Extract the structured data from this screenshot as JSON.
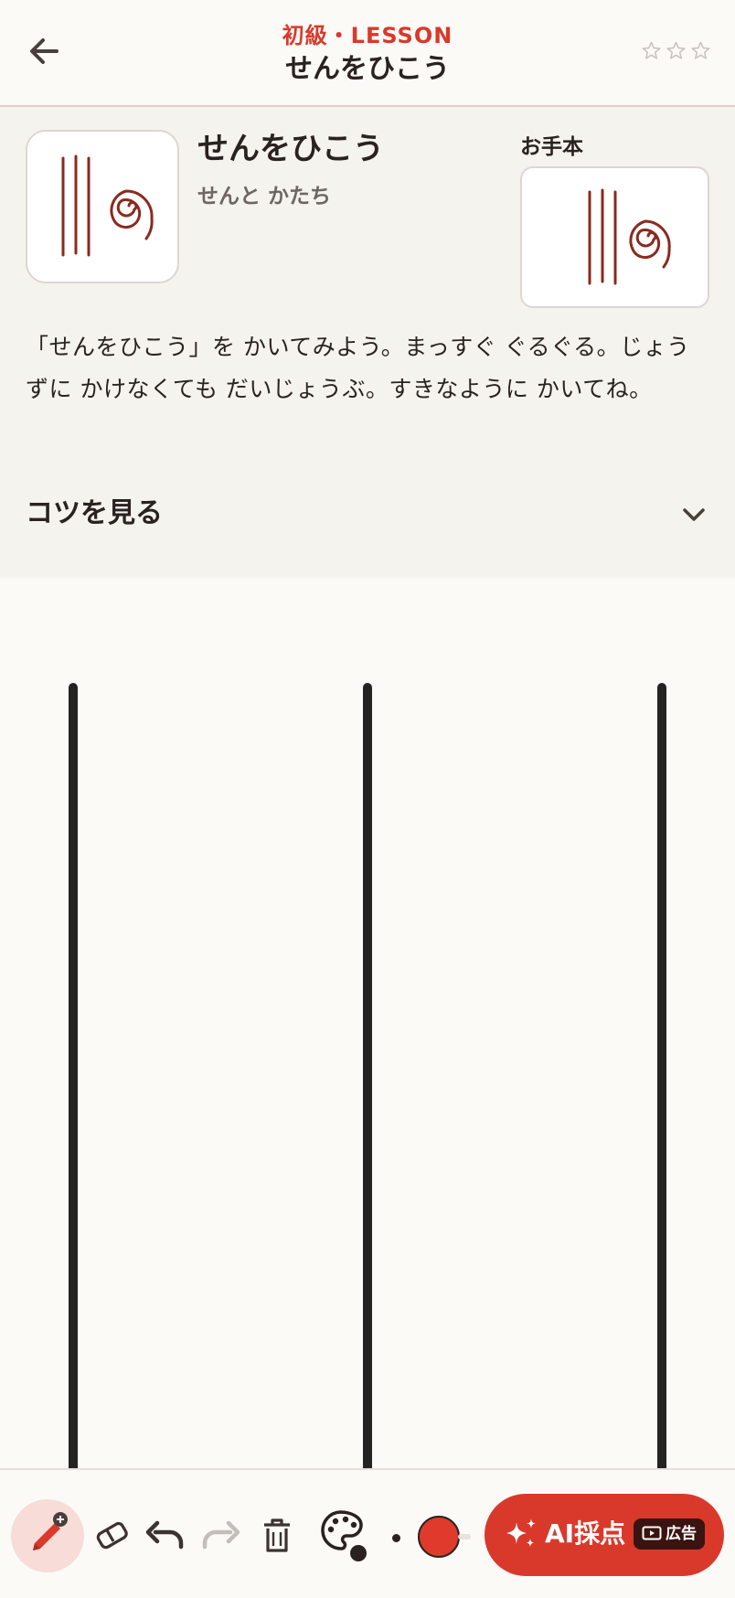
{
  "header": {
    "back_icon": "arrow-left-icon",
    "level_lesson": "初級・LESSON",
    "title": "せんをひこう",
    "stars": {
      "earned": 0,
      "total": 3
    }
  },
  "lesson": {
    "title": "せんをひこう",
    "category": "せんと かたち",
    "model_label": "お手本",
    "description": "「せんをひこう」を かいてみよう。まっすぐ ぐるぐる。じょうずに かけなくても だいじょうぶ。すきなように かいてね。",
    "tips_label": "コツを見る"
  },
  "toolbar": {
    "tools": [
      "pen-icon",
      "eraser-icon",
      "undo-icon",
      "redo-icon",
      "trash-icon",
      "palette-icon"
    ],
    "current_color": "#df3a2c",
    "ai_button_label": "AI採点",
    "ad_badge_label": "広告"
  },
  "colors": {
    "accent": "#d9392b",
    "ink": "#2a2220",
    "panel": "#f5f3ee",
    "background": "#fbfaf6"
  }
}
